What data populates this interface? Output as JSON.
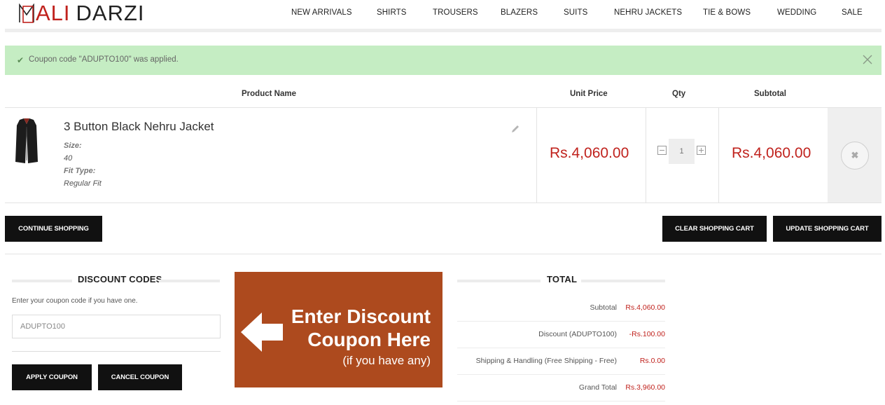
{
  "brand": {
    "name_red": "ALI",
    "name_dark": "DARZI",
    "accent_color": "#c0221d"
  },
  "nav": [
    "NEW ARRIVALS",
    "SHIRTS",
    "TROUSERS",
    "BLAZERS",
    "SUITS",
    "NEHRU JACKETS",
    "TIE & BOWS",
    "WEDDING",
    "SALE"
  ],
  "message": {
    "text": "Coupon code \"ADUPTO100\" was applied.",
    "icon": "check-icon",
    "close_icon": "close-icon"
  },
  "cart": {
    "headers": {
      "product": "Product Name",
      "unit_price": "Unit Price",
      "qty": "Qty",
      "subtotal": "Subtotal"
    },
    "item": {
      "name": "3 Button Black Nehru Jacket",
      "options": [
        {
          "label": "Size:",
          "value": "40"
        },
        {
          "label": "Fit Type:",
          "value": "Regular Fit"
        }
      ],
      "unit_price": "Rs.4,060.00",
      "qty": "1",
      "subtotal": "Rs.4,060.00"
    }
  },
  "buttons": {
    "continue": "CONTINUE SHOPPING",
    "clear": "CLEAR SHOPPING CART",
    "update": "UPDATE SHOPPING CART",
    "apply": "APPLY COUPON",
    "cancel": "CANCEL COUPON"
  },
  "discount": {
    "title": "DISCOUNT CODES",
    "hint": "Enter your coupon code if you have one.",
    "code": "ADUPTO100"
  },
  "banner": {
    "line1": "Enter Discount",
    "line2": "Coupon Here",
    "line3": "(if you have any)",
    "color": "#ad4a1e"
  },
  "totals": {
    "title": "TOTAL",
    "rows": [
      {
        "label": "Subtotal",
        "value": "Rs.4,060.00"
      },
      {
        "label": "Discount (ADUPTO100)",
        "value": "-Rs.100.00"
      },
      {
        "label": "Shipping & Handling (Free Shipping - Free)",
        "value": "Rs.0.00"
      },
      {
        "label": "Grand Total",
        "value": "Rs.3,960.00"
      }
    ]
  }
}
